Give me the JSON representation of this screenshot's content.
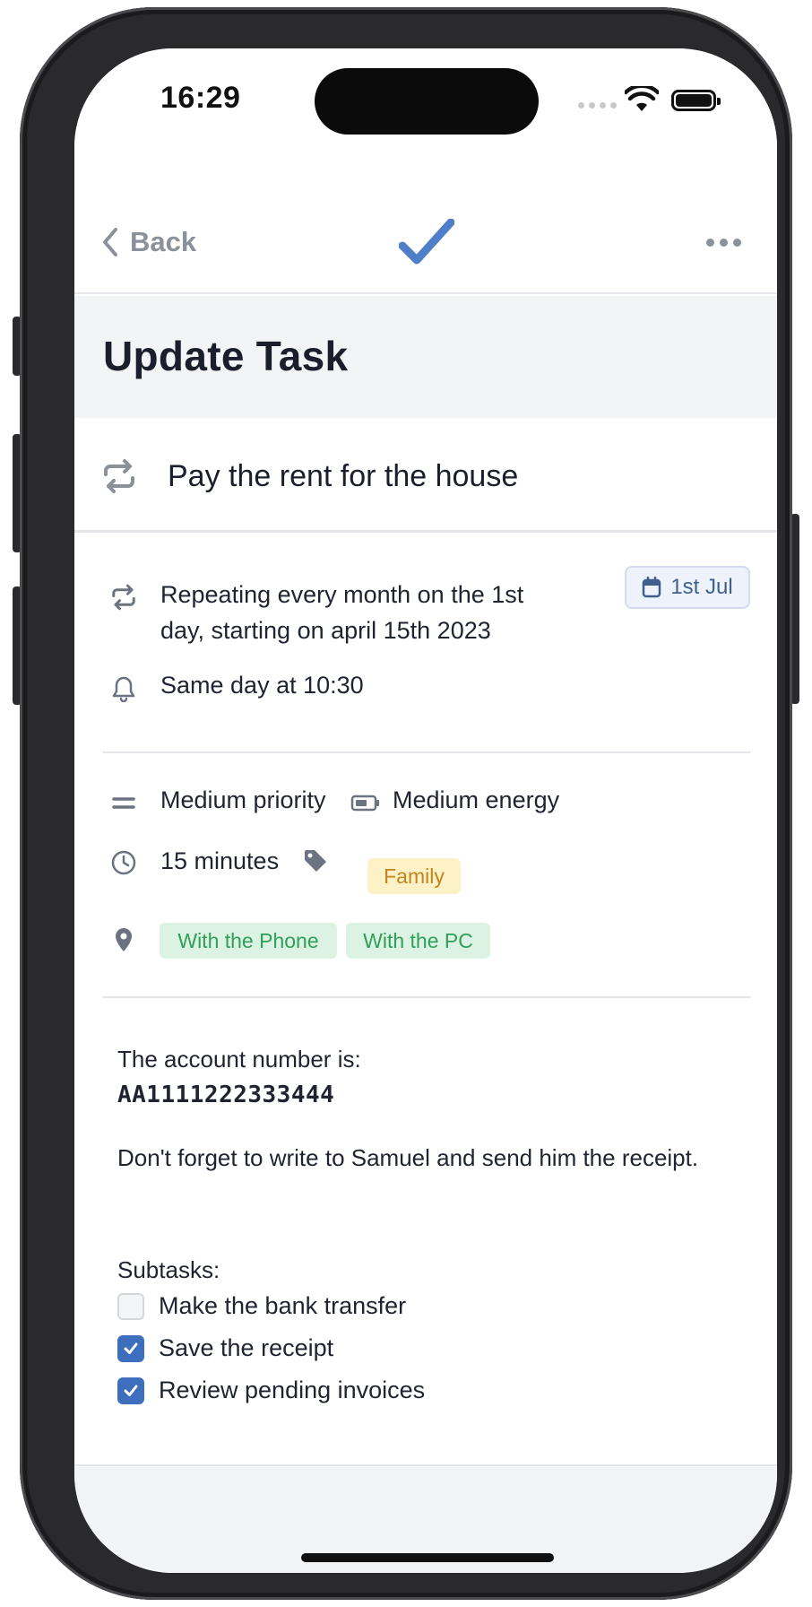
{
  "status_bar": {
    "time": "16:29"
  },
  "nav": {
    "back_label": "Back"
  },
  "page": {
    "title": "Update Task"
  },
  "task": {
    "name": "Pay the rent for the house",
    "repeat_text": "Repeating every month on the 1st day, starting on april 15th 2023",
    "date_chip": "1st Jul",
    "reminder": "Same day at 10:30",
    "priority": "Medium priority",
    "energy": "Medium energy",
    "duration": "15 minutes",
    "tags": [
      "Family"
    ],
    "contexts": [
      "With the Phone",
      "With the PC"
    ]
  },
  "notes": {
    "line1": "The account number is:",
    "account": "AA1111222333444",
    "line2": "Don't forget to write to Samuel and send him the receipt.",
    "subtasks_label": "Subtasks:"
  },
  "subtasks": [
    {
      "label": "Make the bank transfer",
      "checked": false
    },
    {
      "label": "Save the receipt",
      "checked": true
    },
    {
      "label": "Review pending invoices",
      "checked": true
    }
  ],
  "colors": {
    "accent": "#3e6fbf",
    "family_tag_bg": "#fdf1c7",
    "family_tag_text": "#c4851c",
    "context_tag_bg": "#dcf3e3",
    "context_tag_text": "#2f9f5a"
  }
}
